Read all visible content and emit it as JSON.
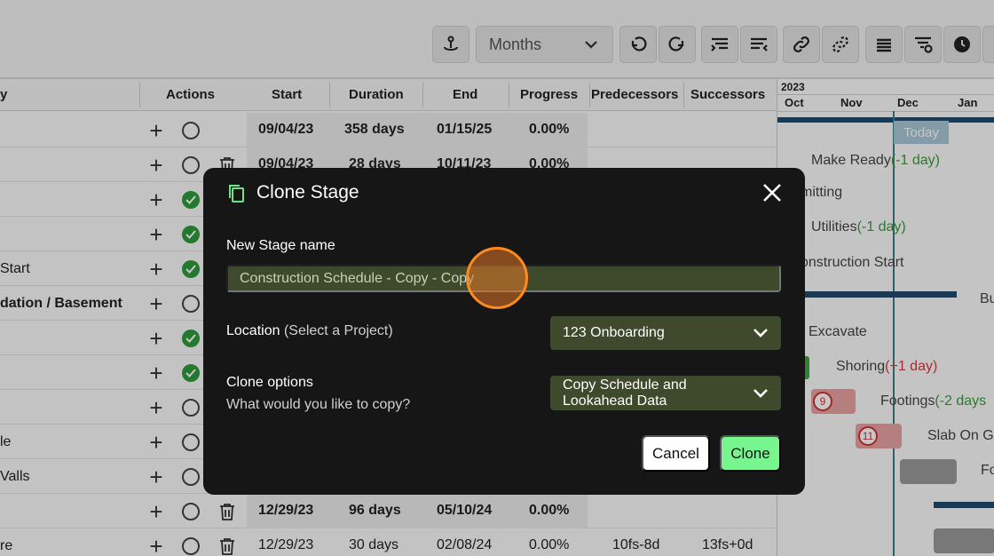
{
  "toolbar": {
    "zoom_select_value": "Months"
  },
  "grid": {
    "headers": {
      "name": "y",
      "actions": "Actions",
      "start": "Start",
      "duration": "Duration",
      "end": "End",
      "progress": "Progress",
      "predecessors": "Predecessors",
      "successors": "Successors"
    },
    "rows": [
      {
        "name": "",
        "start": "09/04/23",
        "duration": "358 days",
        "end": "01/15/25",
        "progress": "0.00%",
        "pred": "",
        "succ": ""
      },
      {
        "name": "",
        "start": "09/04/23",
        "duration": "28 days",
        "end": "10/11/23",
        "progress": "0.00%",
        "pred": "",
        "succ": ""
      },
      {
        "name": "",
        "start": "",
        "duration": "",
        "end": "",
        "progress": "",
        "pred": "",
        "succ": ""
      },
      {
        "name": "",
        "start": "",
        "duration": "",
        "end": "",
        "progress": "",
        "pred": "",
        "succ": ""
      },
      {
        "name": "Start",
        "start": "",
        "duration": "",
        "end": "",
        "progress": "",
        "pred": "",
        "succ": ""
      },
      {
        "name": "dation / Basement",
        "start": "",
        "duration": "",
        "end": "",
        "progress": "",
        "pred": "",
        "succ": ""
      },
      {
        "name": "",
        "start": "",
        "duration": "",
        "end": "",
        "progress": "",
        "pred": "",
        "succ": ""
      },
      {
        "name": "",
        "start": "",
        "duration": "",
        "end": "",
        "progress": "",
        "pred": "",
        "succ": ""
      },
      {
        "name": "",
        "start": "",
        "duration": "",
        "end": "",
        "progress": "",
        "pred": "",
        "succ": ""
      },
      {
        "name": "le",
        "start": "",
        "duration": "",
        "end": "",
        "progress": "",
        "pred": "",
        "succ": ""
      },
      {
        "name": "Valls",
        "start": "",
        "duration": "",
        "end": "",
        "progress": "",
        "pred": "",
        "succ": ""
      },
      {
        "name": "",
        "start": "12/29/23",
        "duration": "96 days",
        "end": "05/10/24",
        "progress": "0.00%",
        "pred": "",
        "succ": ""
      },
      {
        "name": "re",
        "start": "12/29/23",
        "duration": "30 days",
        "end": "02/08/24",
        "progress": "0.00%",
        "pred": "10fs-8d",
        "succ": "13fs+0d"
      }
    ]
  },
  "gantt": {
    "year": "2023",
    "months": [
      "Oct",
      "Nov",
      "Dec",
      "Jan"
    ],
    "today_label": "Today",
    "tasks": [
      {
        "label": "Make Ready",
        "delay": "(-1 day)"
      },
      {
        "label": "mitting",
        "delay": ""
      },
      {
        "label": "Utilities",
        "delay": "(-1 day)"
      },
      {
        "label": "onstruction Start",
        "delay": ""
      },
      {
        "label": "Bu",
        "delay": ""
      },
      {
        "label": "Excavate",
        "delay": ""
      },
      {
        "label": "Shoring",
        "delay": "(+1 day)"
      },
      {
        "label": "Footings",
        "delay": "(-2 days"
      },
      {
        "label": "Slab On G",
        "delay": ""
      },
      {
        "label": "Fo",
        "delay": ""
      }
    ],
    "badges": [
      "9",
      "11"
    ]
  },
  "modal": {
    "title": "Clone Stage",
    "stage_name_label": "New Stage name",
    "stage_name_value": "Construction Schedule - Copy - Copy",
    "location_label": "Location",
    "location_hint": "(Select a Project)",
    "location_value": "123 Onboarding",
    "clone_options_label": "Clone options",
    "clone_options_hint": "What would you like to copy?",
    "clone_options_value_line1": "Copy Schedule and",
    "clone_options_value_line2": "Lookahead Data",
    "cancel_label": "Cancel",
    "clone_label": "Clone"
  },
  "colors": {
    "modal_bg": "#161616",
    "field_bg": "#3f4a2c",
    "accent_green": "#77f58e",
    "icon_green": "#6fe38a",
    "cursor_orange": "#ff8a1d"
  }
}
